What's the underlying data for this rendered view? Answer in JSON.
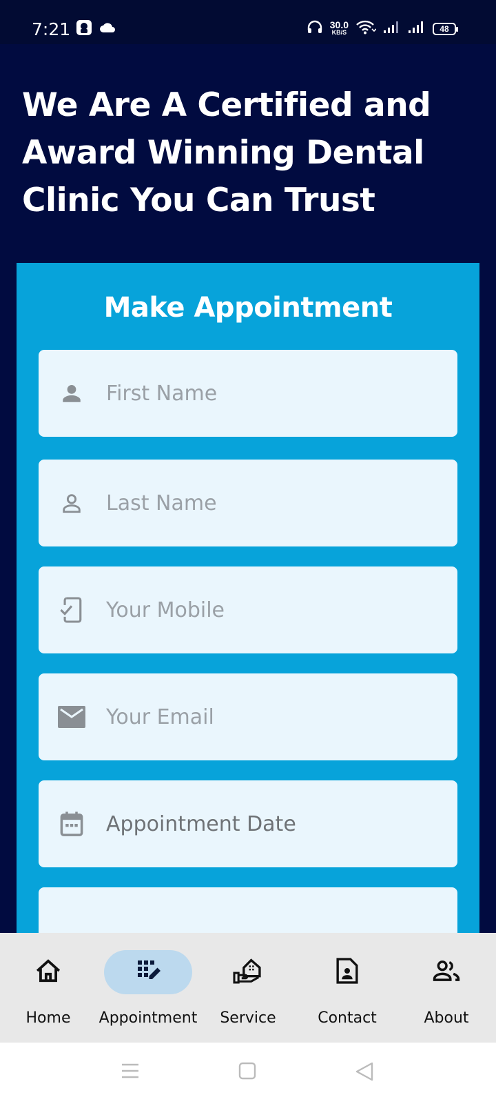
{
  "status_bar": {
    "time": "7:21",
    "net_speed_value": "30.0",
    "net_speed_unit": "KB/S",
    "battery": "48"
  },
  "hero": {
    "title": "We Are A Certified and Award Winning Dental Clinic You Can Trust"
  },
  "form": {
    "title": "Make Appointment",
    "fields": [
      {
        "icon": "person-icon",
        "placeholder": "First Name"
      },
      {
        "icon": "person-outline-icon",
        "placeholder": "Last Name"
      },
      {
        "icon": "mobile-check-icon",
        "placeholder": "Your Mobile"
      },
      {
        "icon": "email-icon",
        "placeholder": "Your Email"
      },
      {
        "icon": "calendar-icon",
        "placeholder": "Appointment Date"
      }
    ]
  },
  "bottom_nav": {
    "items": [
      {
        "label": "Home",
        "icon": "home-icon",
        "active": false
      },
      {
        "label": "Appointment",
        "icon": "grid-edit-icon",
        "active": true
      },
      {
        "label": "Service",
        "icon": "service-hand-icon",
        "active": false
      },
      {
        "label": "Contact",
        "icon": "contact-file-icon",
        "active": false
      },
      {
        "label": "About",
        "icon": "people-icon",
        "active": false
      }
    ]
  },
  "colors": {
    "background": "#010b40",
    "card": "#07a3da",
    "field": "#eaf6fd",
    "nav_active": "#bcd9ee"
  }
}
